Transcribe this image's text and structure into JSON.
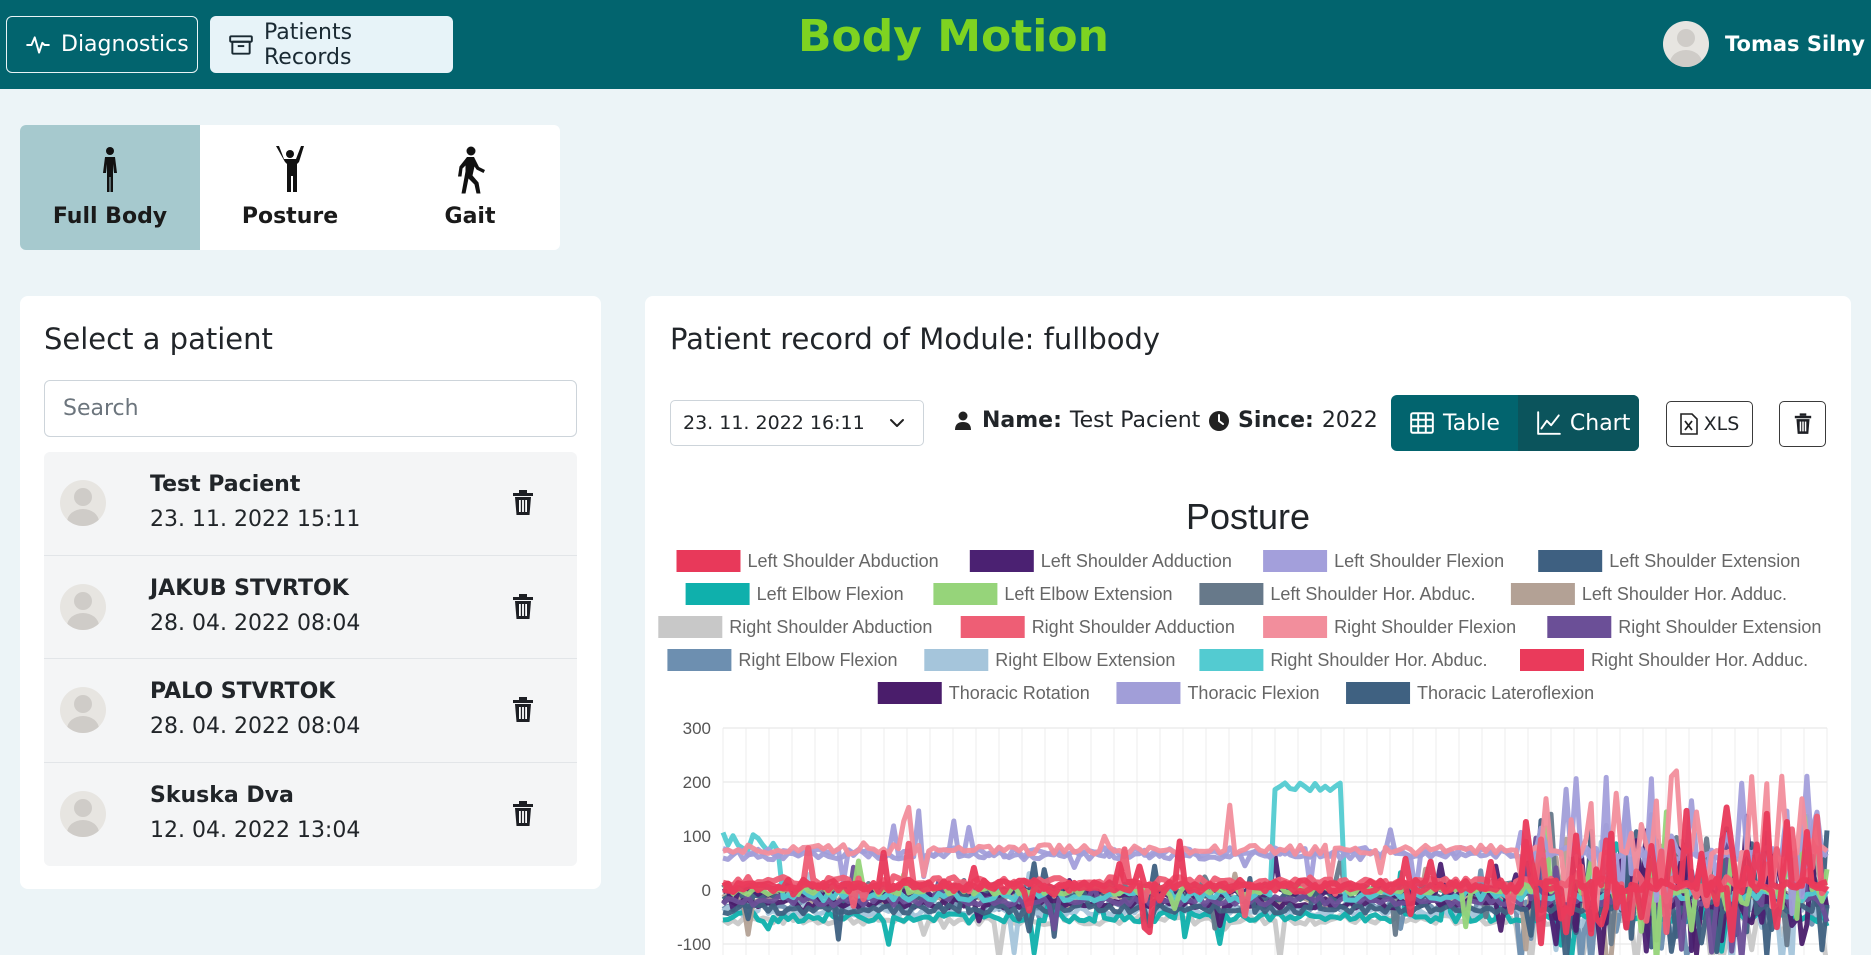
{
  "header": {
    "diagnostics_label": "Diagnostics",
    "records_label": "Patients Records",
    "brand": "Body Motion",
    "user_name": "Tomas Silny"
  },
  "modes": [
    {
      "label": "Full Body",
      "active": true
    },
    {
      "label": "Posture",
      "active": false
    },
    {
      "label": "Gait",
      "active": false
    }
  ],
  "patients_panel": {
    "title": "Select a patient",
    "search_placeholder": "Search",
    "items": [
      {
        "name": "Test Pacient",
        "date": "23. 11. 2022 15:11"
      },
      {
        "name": "JAKUB STVRTOK",
        "date": "28. 04. 2022 08:04"
      },
      {
        "name": "PALO STVRTOK",
        "date": "28. 04. 2022 08:04"
      },
      {
        "name": "Skuska Dva",
        "date": "12. 04. 2022 13:04"
      }
    ]
  },
  "record_panel": {
    "title": "Patient record of Module: fullbody",
    "selected_date": "23. 11. 2022 16:11",
    "name_label": "Name:",
    "name_value": "Test Pacient",
    "since_label": "Since:",
    "since_value": "2022",
    "table_label": "Table",
    "chart_label": "Chart",
    "view_mode": "chart",
    "xls_label": "XLS"
  },
  "colors": {
    "header_bg": "#02646e",
    "brand": "#7ed321",
    "page_bg": "#ecf4f7",
    "mode_active": "#a6c9ce"
  },
  "chart_data": {
    "type": "line",
    "title": "Posture",
    "ylim": [
      -100,
      300
    ],
    "yticks": [
      300,
      200,
      100,
      0,
      -100
    ],
    "grid": true,
    "legend_position": "top",
    "series": [
      {
        "name": "Left Shoulder Abduction",
        "color": "#e8395a",
        "level": 10
      },
      {
        "name": "Left Shoulder Adduction",
        "color": "#4b2172",
        "level": -5
      },
      {
        "name": "Left Shoulder Flexion",
        "color": "#a39fdb",
        "level": 70
      },
      {
        "name": "Left Shoulder Extension",
        "color": "#3e6081",
        "level": -10
      },
      {
        "name": "Left Elbow Flexion",
        "color": "#0fb0ac",
        "level": -50
      },
      {
        "name": "Left Elbow Extension",
        "color": "#96d47a",
        "level": 0
      },
      {
        "name": "Left Shoulder Hor. Abduc.",
        "color": "#67798a",
        "level": 5
      },
      {
        "name": "Left Shoulder Hor. Adduc.",
        "color": "#b3a195",
        "level": -15
      },
      {
        "name": "Right Shoulder Abduction",
        "color": "#c8c8c8",
        "level": -55
      },
      {
        "name": "Right Shoulder Adduction",
        "color": "#ee5e75",
        "level": 15
      },
      {
        "name": "Right Shoulder Flexion",
        "color": "#f28e9c",
        "level": 75
      },
      {
        "name": "Right Shoulder Extension",
        "color": "#6b4f97",
        "level": -20
      },
      {
        "name": "Right Elbow Flexion",
        "color": "#6d8fb0",
        "level": -30
      },
      {
        "name": "Right Elbow Extension",
        "color": "#a5c5db",
        "level": -40
      },
      {
        "name": "Right Shoulder Hor. Abduc.",
        "color": "#53cbd1",
        "level": 190
      },
      {
        "name": "Right Shoulder Hor. Adduc.",
        "color": "#ea3a5b",
        "level": 5
      },
      {
        "name": "Thoracic Rotation",
        "color": "#4a1d6b",
        "level": -25
      },
      {
        "name": "Thoracic Flexion",
        "color": "#a19ed8",
        "level": 65
      },
      {
        "name": "Thoracic Lateroflexion",
        "color": "#3f6181",
        "level": -35
      }
    ]
  }
}
